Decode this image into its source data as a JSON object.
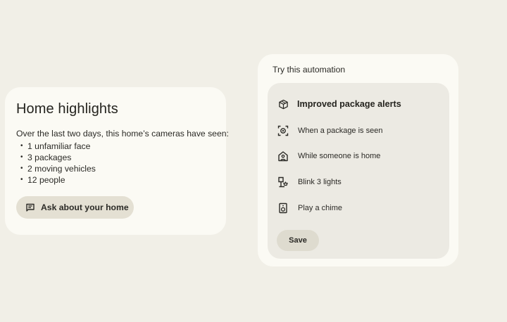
{
  "highlights": {
    "title": "Home highlights",
    "intro": "Over the last two days, this home’s cameras have seen:",
    "items": [
      "1 unfamiliar face",
      "3 packages",
      "2 moving vehicles",
      "12 people"
    ],
    "ask_button": {
      "label": "Ask about your home",
      "icon": "chat-edit-icon"
    }
  },
  "automation": {
    "header": "Try this automation",
    "title": {
      "label": "Improved package alerts",
      "icon": "package-icon"
    },
    "items": [
      {
        "label": "When a package is seen",
        "icon": "camera-detect-icon"
      },
      {
        "label": "While someone is home",
        "icon": "home-person-icon"
      },
      {
        "label": "Blink 3 lights",
        "icon": "lamp-icon"
      },
      {
        "label": "Play a chime",
        "icon": "speaker-icon"
      }
    ],
    "save_label": "Save"
  }
}
